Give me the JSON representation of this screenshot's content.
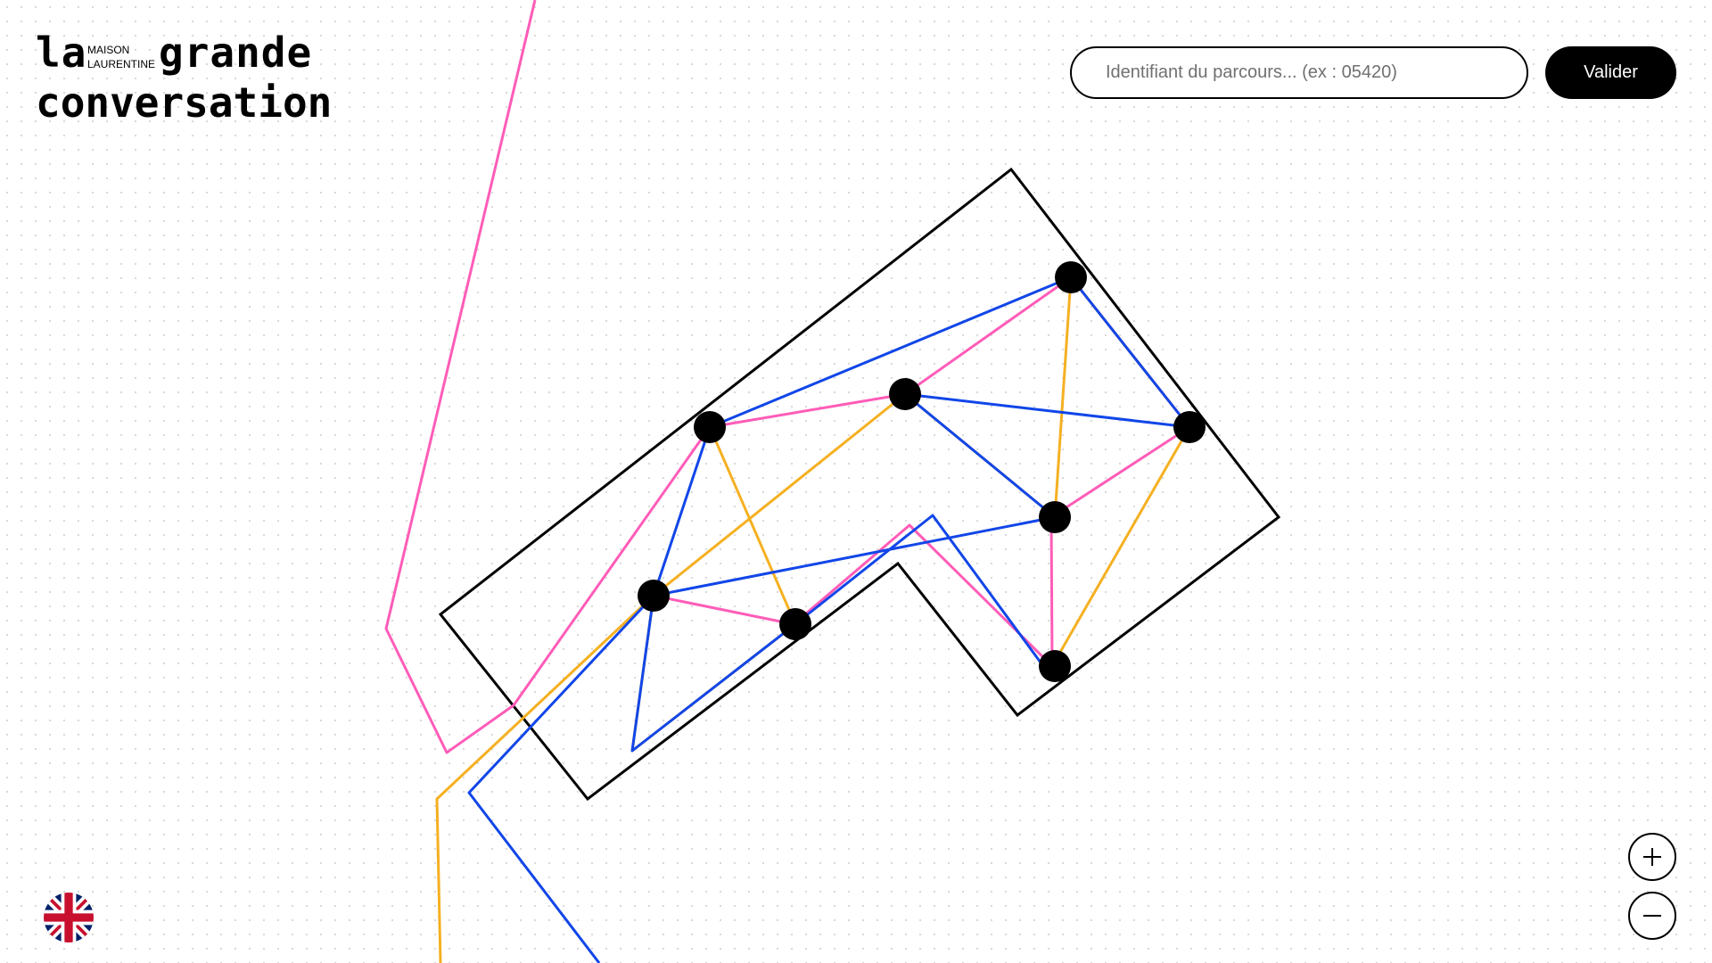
{
  "logo": {
    "la": "la",
    "maison_line1": "MAISON",
    "maison_line2": "LAURENTINE",
    "grande": "grande",
    "conversation": "conversation"
  },
  "search": {
    "placeholder": "Identifiant du parcours... (ex : 05420)",
    "value": ""
  },
  "submit_button": {
    "label": "Valider"
  },
  "zoom": {
    "in_icon": "plus-icon",
    "out_icon": "minus-icon"
  },
  "language": {
    "flag_icon": "uk-flag-icon"
  },
  "colors": {
    "pink": "#ff5cb8",
    "yellow": "#f5b021",
    "blue": "#1146e8",
    "outline": "#000000",
    "node": "#000000"
  }
}
